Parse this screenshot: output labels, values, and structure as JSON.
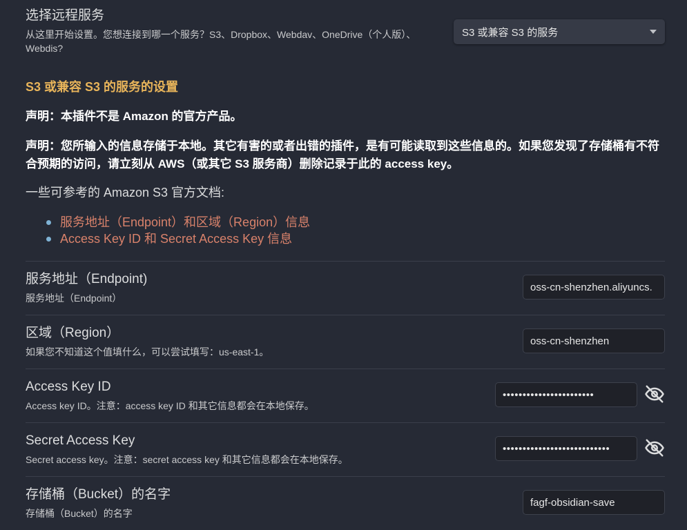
{
  "remote": {
    "title": "选择远程服务",
    "desc": "从这里开始设置。您想连接到哪一个服务？S3、Dropbox、Webdav、OneDrive（个人版）、Webdis?",
    "selected": "S3 或兼容 S3 的服务"
  },
  "s3": {
    "heading": "S3 或兼容 S3 的服务的设置",
    "disclaimer1": "声明：本插件不是 Amazon 的官方产品。",
    "disclaimer2": "声明：您所输入的信息存储于本地。其它有害的或者出错的插件，是有可能读取到这些信息的。如果您发现了存储桶有不符合预期的访问，请立刻从 AWS（或其它 S3 服务商）删除记录于此的 access key。",
    "docs_intro": "一些可参考的 Amazon S3 官方文档:",
    "links": [
      "服务地址（Endpoint）和区域（Region）信息",
      "Access Key ID 和 Secret Access Key 信息"
    ]
  },
  "settings": [
    {
      "name": "服务地址（Endpoint)",
      "desc": "服务地址（Endpoint）",
      "value": "oss-cn-shenzhen.aliyuncs."
    },
    {
      "name": "区域（Region）",
      "desc": "如果您不知道这个值填什么，可以尝试填写：us-east-1。",
      "value": "oss-cn-shenzhen"
    },
    {
      "name": "Access Key ID",
      "desc": "Access key ID。注意：access key ID 和其它信息都会在本地保存。",
      "value": "•••••••••••••••••••••••"
    },
    {
      "name": "Secret Access Key",
      "desc": "Secret access key。注意：secret access key 和其它信息都会在本地保存。",
      "value": "•••••••••••••••••••••••••••"
    },
    {
      "name": "存储桶（Bucket）的名字",
      "desc": "存储桶（Bucket）的名字",
      "value": "fagf-obsidian-save"
    }
  ],
  "icons": {
    "toggle_visibility": "eye-off-icon"
  }
}
